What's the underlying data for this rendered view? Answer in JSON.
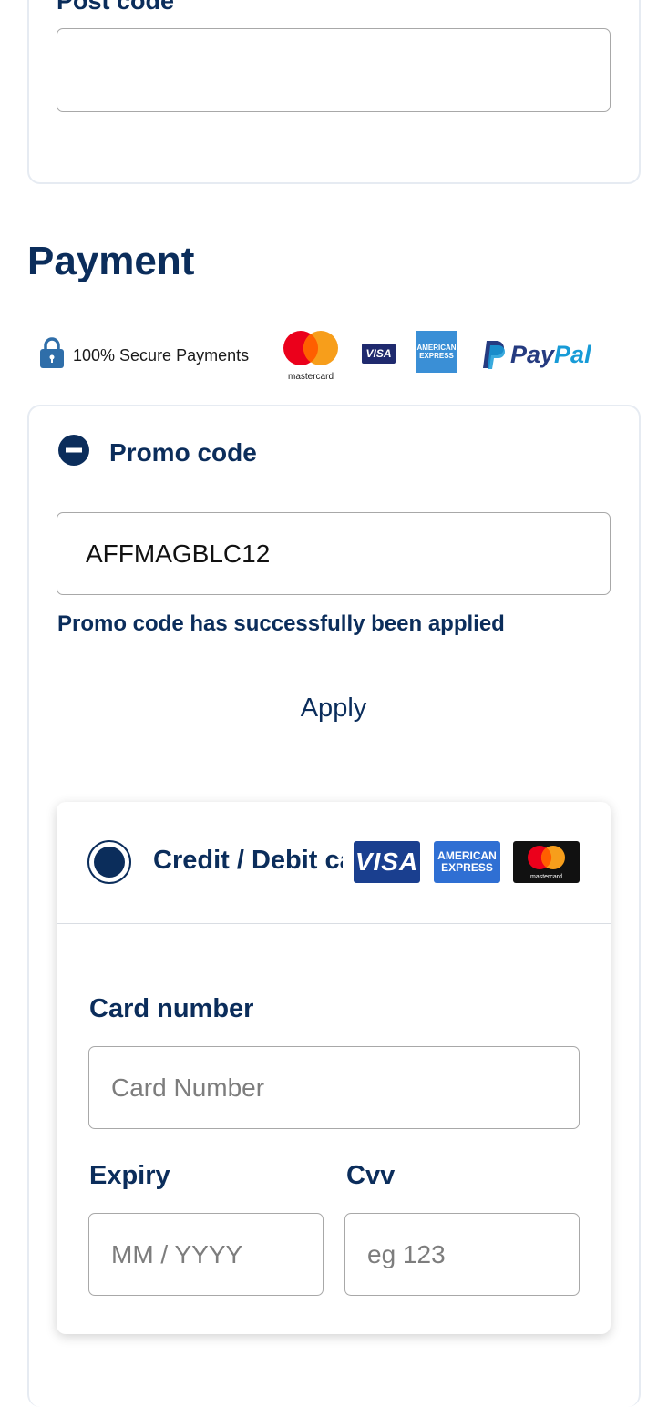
{
  "address": {
    "postcode_label": "Post code",
    "postcode_value": ""
  },
  "payment": {
    "title": "Payment",
    "secure_text": "100% Secure Payments",
    "logos": {
      "mastercard": "mastercard",
      "visa": "VISA",
      "amex_line1": "AMERICAN",
      "amex_line2": "EXPRESS",
      "paypal_pay": "Pay",
      "paypal_pal": "Pal"
    }
  },
  "promo": {
    "label": "Promo code",
    "value": "AFFMAGBLC12",
    "success_message": "Promo code has successfully been applied",
    "apply_label": "Apply"
  },
  "method": {
    "label": "Credit / Debit card",
    "logos": {
      "visa": "VISA",
      "amex_line1": "AMERICAN",
      "amex_line2": "EXPRESS",
      "mastercard": "mastercard"
    },
    "card_number_label": "Card number",
    "card_number_placeholder": "Card Number",
    "expiry_label": "Expiry",
    "expiry_placeholder": "MM / YYYY",
    "cvv_label": "Cvv",
    "cvv_placeholder": "eg 123"
  },
  "colors": {
    "primary": "#0b2d5b",
    "border": "#a8a8a8",
    "card_border": "#e6ebf2"
  }
}
